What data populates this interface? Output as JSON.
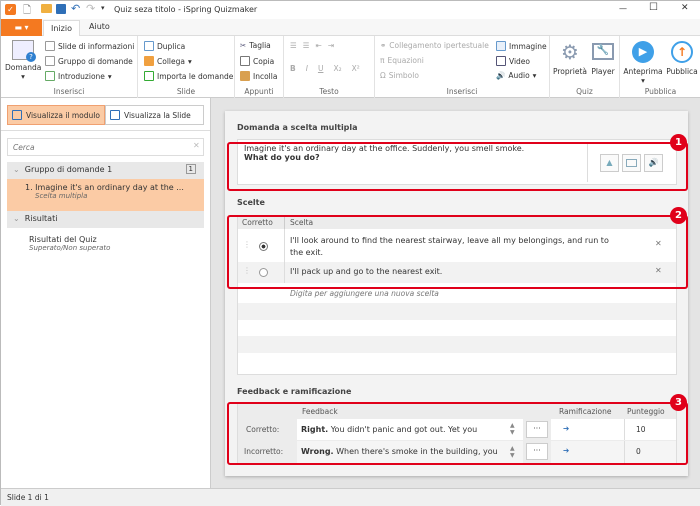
{
  "window": {
    "title": "Quiz seza titolo - iSpring Quizmaker",
    "minimize": "—",
    "maximize": "☐",
    "close": "✕"
  },
  "tabs": [
    {
      "label": "Inizio",
      "active": true
    },
    {
      "label": "Aiuto"
    }
  ],
  "ribbon": {
    "inserisci1": {
      "label": "Inserisci",
      "domanda": "Domanda",
      "items": [
        "Slide di informazioni",
        "Gruppo di domande",
        "Introduzione"
      ]
    },
    "slide": {
      "label": "Slide",
      "items": [
        "Duplica",
        "Collega",
        "Importa le domande"
      ]
    },
    "appunti": {
      "label": "Appunti",
      "items": [
        "Taglia",
        "Copia",
        "Incolla"
      ]
    },
    "testo": {
      "label": "Testo",
      "buttons": [
        "B",
        "I",
        "U",
        "X₂",
        "X²"
      ]
    },
    "inserisci2": {
      "label": "Inserisci",
      "items": [
        "Collegamento ipertestuale",
        "Equazioni",
        "Simbolo"
      ],
      "media": [
        "Immagine",
        "Video",
        "Audio"
      ]
    },
    "quiz": {
      "label": "Quiz",
      "items": [
        "Proprietà",
        "Player"
      ]
    },
    "pubblica": {
      "label": "Pubblica",
      "items": [
        "Anteprima",
        "Pubblica"
      ]
    }
  },
  "left": {
    "view_form": "Visualizza il modulo",
    "view_slide": "Visualizza la Slide",
    "search_placeholder": "Cerca",
    "group": {
      "label": "Gruppo di domande 1",
      "count": "1"
    },
    "question": {
      "label": "1.  Imagine it's an ordinary day at the ...",
      "type": "Scelta multipla"
    },
    "results_header": "Risultati",
    "results": {
      "label": "Risultati del Quiz",
      "sub": "Superato/Non superato"
    }
  },
  "question": {
    "section": "Domanda a scelta multipla",
    "text": "Imagine it's an ordinary day at the office. Suddenly, you smell smoke.",
    "bold": "What do you do?"
  },
  "choices": {
    "section": "Scelte",
    "col_correct": "Corretto",
    "col_choice": "Scelta",
    "rows": [
      {
        "text": "I'll look around to find the nearest stairway, leave all my belongings, and run to the exit.",
        "correct": true
      },
      {
        "text": "I'll pack up and go to the nearest exit.",
        "correct": false
      }
    ],
    "add_placeholder": "Digita per aggiungere una nuova scelta"
  },
  "feedback": {
    "section": "Feedback e ramificazione",
    "col_feedback": "Feedback",
    "col_branch": "Ramificazione",
    "col_score": "Punteggio",
    "rows": [
      {
        "label": "Corretto:",
        "bold": "Right.",
        "text": " You didn't panic and got out. Yet you",
        "score": "10"
      },
      {
        "label": "Incorretto:",
        "bold": "Wrong.",
        "text": " When there's smoke in the building, you",
        "score": "0"
      }
    ]
  },
  "badges": [
    "1",
    "2",
    "3"
  ],
  "status": "Slide 1 di 1",
  "colors": {
    "accent": "#f47920",
    "selection": "#fbcba5",
    "highlight": "#e0001a"
  }
}
